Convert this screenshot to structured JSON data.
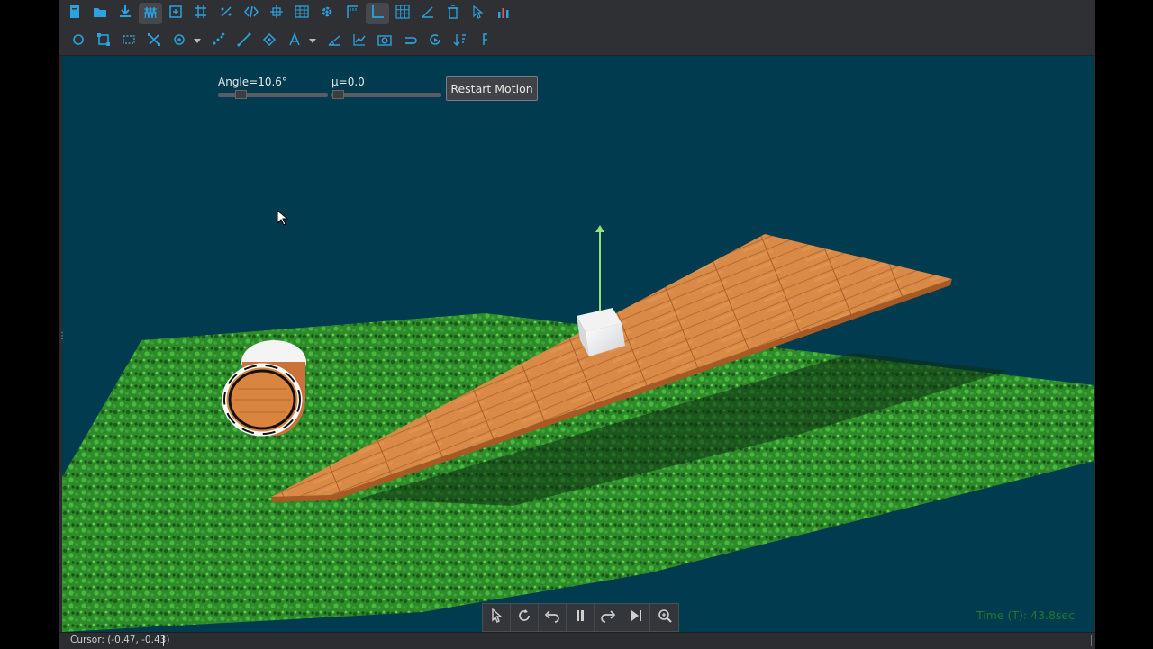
{
  "toolbar_top": {
    "buttons": [
      {
        "icon": "new-file-icon",
        "color": "#2aa3e0"
      },
      {
        "icon": "open-folder-icon",
        "color": "#2aa3e0"
      },
      {
        "icon": "import-icon",
        "color": "#2aa3e0"
      },
      {
        "icon": "wave-icon",
        "color": "#2aa3e0",
        "active": true
      },
      {
        "icon": "transform-icon",
        "color": "#2aa3e0"
      },
      {
        "icon": "grid-split-icon",
        "color": "#2aa3e0"
      },
      {
        "icon": "fraction-icon",
        "color": "#2aa3e0"
      },
      {
        "icon": "code-icon",
        "color": "#2aa3e0"
      },
      {
        "icon": "crosshair-icon",
        "color": "#2aa3e0"
      },
      {
        "icon": "table-icon",
        "color": "#2aa3e0"
      },
      {
        "icon": "settings-icon",
        "color": "#2aa3e0"
      },
      {
        "icon": "corner-axes-icon",
        "color": "#2aa3e0"
      },
      {
        "icon": "axes-icon",
        "color": "#2aa3e0",
        "active": true
      },
      {
        "icon": "grid-icon",
        "color": "#2aa3e0"
      },
      {
        "icon": "angle-icon",
        "color": "#2aa3e0"
      },
      {
        "icon": "trash-icon",
        "color": "#2aa3e0"
      },
      {
        "icon": "pointer-star-icon",
        "color": "#2aa3e0"
      },
      {
        "icon": "bar-chart-icon",
        "color": "#2aa3e0"
      }
    ]
  },
  "toolbar_second": {
    "buttons": [
      {
        "icon": "circle-icon"
      },
      {
        "icon": "square-select-icon"
      },
      {
        "icon": "dashed-box-icon"
      },
      {
        "icon": "shape-select-icon"
      },
      {
        "icon": "target-icon",
        "dropdown": true
      },
      {
        "icon": "scatter-icon"
      },
      {
        "icon": "line-tool-icon"
      },
      {
        "icon": "diamond-point-icon"
      },
      {
        "icon": "text-tool-icon",
        "dropdown": true
      },
      {
        "icon": "angle-measure-icon"
      },
      {
        "icon": "line-chart-icon"
      },
      {
        "icon": "camera-icon"
      },
      {
        "icon": "loop-icon"
      },
      {
        "icon": "refresh-play-icon"
      },
      {
        "icon": "sort-icon"
      },
      {
        "icon": "function-icon"
      }
    ]
  },
  "controls": {
    "angle_label": "Angle=10.6°",
    "angle_value": 10.6,
    "mu_label": "μ=0.0",
    "mu_value": 0.0,
    "restart_label": "Restart Motion"
  },
  "playback": {
    "buttons": [
      "select-arrow-icon",
      "rotate-icon",
      "undo-icon",
      "pause-icon",
      "redo-icon",
      "step-end-icon",
      "zoom-icon"
    ]
  },
  "time_label": "Time (T): 43.8sec",
  "status": {
    "cursor_text": "Cursor: (-0.47, -0.43)"
  },
  "colors": {
    "viewport_bg": "#003b50",
    "grass": "#2f8f2a",
    "wood": "#d9843f",
    "accent_blue": "#2aa3e0"
  }
}
